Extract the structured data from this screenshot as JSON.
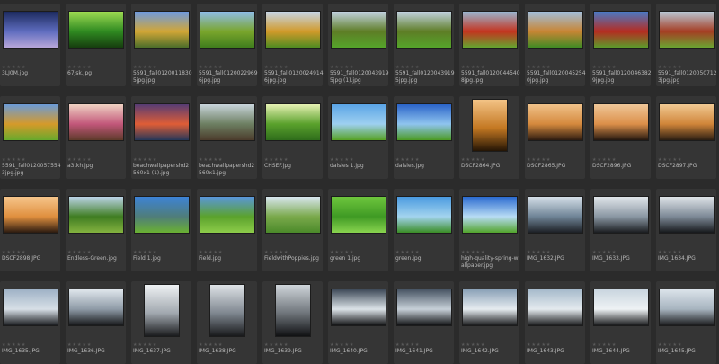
{
  "thumbnails": [
    {
      "filename": "3LJ0M.jpg",
      "colors": [
        "#1c2a5e",
        "#5f6dbf",
        "#b8a7d9"
      ],
      "orientation": "landscape"
    },
    {
      "filename": "67jsk.jpg",
      "colors": [
        "#9edb52",
        "#2f8a21",
        "#163d0f"
      ],
      "orientation": "landscape"
    },
    {
      "filename": "5591_fall01200118305jpg.jpg",
      "colors": [
        "#6e9ae0",
        "#d1a636",
        "#4b6d2a"
      ],
      "orientation": "landscape"
    },
    {
      "filename": "5591_fall01200229696jpg.jpg",
      "colors": [
        "#8fbde8",
        "#7aa52c",
        "#3f7d1d"
      ],
      "orientation": "landscape"
    },
    {
      "filename": "5591_fall01200249146jpg.jpg",
      "colors": [
        "#c7d6e7",
        "#d19a2a",
        "#4e8b21"
      ],
      "orientation": "landscape"
    },
    {
      "filename": "5591_fall01200439195jpg (1).jpg",
      "colors": [
        "#c2d2e0",
        "#5e7d26",
        "#55a52a"
      ],
      "orientation": "landscape"
    },
    {
      "filename": "5591_fall01200439195jpg.jpg",
      "colors": [
        "#c2d2e0",
        "#5e7d26",
        "#55a52a"
      ],
      "orientation": "landscape"
    },
    {
      "filename": "5591_fall01200445408jpg.jpg",
      "colors": [
        "#9ab6d0",
        "#c4341f",
        "#64a52f"
      ],
      "orientation": "landscape"
    },
    {
      "filename": "5591_fall01200452540jpg.jpg",
      "colors": [
        "#a2bfdc",
        "#c88534",
        "#3f8a24"
      ],
      "orientation": "landscape"
    },
    {
      "filename": "5591_fall01200463829jpg.jpg",
      "colors": [
        "#4a79c5",
        "#b52c21",
        "#5c9b2b"
      ],
      "orientation": "landscape"
    },
    {
      "filename": "5591_fall01200507123jpg.jpg",
      "colors": [
        "#b9c7d4",
        "#a53d23",
        "#6aa531"
      ],
      "orientation": "landscape"
    },
    {
      "filename": "5591_fall01200575543jpg.jpg",
      "colors": [
        "#6b9bd8",
        "#d59a2a",
        "#67a92c"
      ],
      "orientation": "landscape"
    },
    {
      "filename": "a3tkh.jpg",
      "colors": [
        "#f0d3c3",
        "#c2577a",
        "#5d3a2a"
      ],
      "orientation": "landscape"
    },
    {
      "filename": "beachwallpapershd2560x1 (1).jpg",
      "colors": [
        "#563c74",
        "#df5d36",
        "#243759"
      ],
      "orientation": "landscape"
    },
    {
      "filename": "beachwallpapershd2560x1.jpg",
      "colors": [
        "#c9d5dc",
        "#6d7f62",
        "#4b3b2b"
      ],
      "orientation": "landscape"
    },
    {
      "filename": "CHSEF.jpg",
      "colors": [
        "#e6f1b3",
        "#5aa12c",
        "#2e6c1b"
      ],
      "orientation": "landscape"
    },
    {
      "filename": "daisies 1.jpg",
      "colors": [
        "#5aa4e6",
        "#9ed0f0",
        "#56a123"
      ],
      "orientation": "landscape"
    },
    {
      "filename": "daisies.jpg",
      "colors": [
        "#2a63c8",
        "#8fc4ef",
        "#4b9a22"
      ],
      "orientation": "landscape"
    },
    {
      "filename": "DSCF2864.JPG",
      "colors": [
        "#f3c386",
        "#c47822",
        "#241505"
      ],
      "orientation": "portrait"
    },
    {
      "filename": "DSCF2865.JPG",
      "colors": [
        "#f0c28a",
        "#d5893d",
        "#2c1b10"
      ],
      "orientation": "landscape"
    },
    {
      "filename": "DSCF2896.JPG",
      "colors": [
        "#efc799",
        "#dc8f49",
        "#23170f"
      ],
      "orientation": "landscape"
    },
    {
      "filename": "DSCF2897.JPG",
      "colors": [
        "#f1c993",
        "#d08539",
        "#2a1d12"
      ],
      "orientation": "landscape"
    },
    {
      "filename": "DSCF2898.JPG",
      "colors": [
        "#f6c58b",
        "#e08f3e",
        "#2a1a10"
      ],
      "orientation": "landscape"
    },
    {
      "filename": "Endless-Green.jpg",
      "colors": [
        "#bcd4e8",
        "#3f7d22",
        "#84b33f"
      ],
      "orientation": "landscape"
    },
    {
      "filename": "Field 1.jpg",
      "colors": [
        "#3d83d6",
        "#4f7d7a",
        "#6ab132"
      ],
      "orientation": "landscape"
    },
    {
      "filename": "Field.jpg",
      "colors": [
        "#5a96da",
        "#5ba22c",
        "#8dcc4a"
      ],
      "orientation": "landscape"
    },
    {
      "filename": "FieldwithPoppies.jpg",
      "colors": [
        "#d9e6ef",
        "#7aa94b",
        "#4b8a2a"
      ],
      "orientation": "landscape"
    },
    {
      "filename": "green 1.jpg",
      "colors": [
        "#6ec63d",
        "#3f9a24",
        "#89d44f"
      ],
      "orientation": "landscape"
    },
    {
      "filename": "green.jpg",
      "colors": [
        "#4a9ae0",
        "#a3d4ee",
        "#3a8d25"
      ],
      "orientation": "landscape"
    },
    {
      "filename": "high-quality-spring-wallpaper.jpg",
      "colors": [
        "#2b6ad0",
        "#b8dcf4",
        "#52a42b"
      ],
      "orientation": "landscape"
    },
    {
      "filename": "IMG_1632.JPG",
      "colors": [
        "#d5dfe8",
        "#6f8496",
        "#1c1f24"
      ],
      "orientation": "landscape"
    },
    {
      "filename": "IMG_1633.JPG",
      "colors": [
        "#e1e6ea",
        "#8a97a3",
        "#1a1c1f"
      ],
      "orientation": "landscape"
    },
    {
      "filename": "IMG_1634.JPG",
      "colors": [
        "#dfe4e8",
        "#7d8996",
        "#16181b"
      ],
      "orientation": "landscape"
    },
    {
      "filename": "IMG_1635.JPG",
      "colors": [
        "#9fb2c6",
        "#d7dfe6",
        "#1b1d20"
      ],
      "orientation": "landscape"
    },
    {
      "filename": "IMG_1636.JPG",
      "colors": [
        "#dfe6ec",
        "#8e9aa6",
        "#17181a"
      ],
      "orientation": "landscape"
    },
    {
      "filename": "IMG_1637.JPG",
      "colors": [
        "#eef1f3",
        "#a1a8af",
        "#1a1b1d"
      ],
      "orientation": "portrait"
    },
    {
      "filename": "IMG_1638.JPG",
      "colors": [
        "#dde2e6",
        "#7f8790",
        "#18191b"
      ],
      "orientation": "portrait"
    },
    {
      "filename": "IMG_1639.JPG",
      "colors": [
        "#cfd5da",
        "#6f757b",
        "#101113"
      ],
      "orientation": "portrait"
    },
    {
      "filename": "IMG_1640.JPG",
      "colors": [
        "#3e4a58",
        "#dce3e8",
        "#121315"
      ],
      "orientation": "landscape"
    },
    {
      "filename": "IMG_1641.JPG",
      "colors": [
        "#475463",
        "#c7d0d8",
        "#111214"
      ],
      "orientation": "landscape"
    },
    {
      "filename": "IMG_1642.JPG",
      "colors": [
        "#8aa1b7",
        "#e6ecf0",
        "#1a1b1d"
      ],
      "orientation": "landscape"
    },
    {
      "filename": "IMG_1643.JPG",
      "colors": [
        "#a6bacb",
        "#e4eaee",
        "#1b1c1e"
      ],
      "orientation": "landscape"
    },
    {
      "filename": "IMG_1644.JPG",
      "colors": [
        "#c9d5df",
        "#eef2f4",
        "#191a1c"
      ],
      "orientation": "landscape"
    },
    {
      "filename": "IMG_1645.JPG",
      "colors": [
        "#dbe3ea",
        "#a7b4bf",
        "#1a1b1d"
      ],
      "orientation": "landscape"
    }
  ],
  "rating_stars": "★★★★★"
}
